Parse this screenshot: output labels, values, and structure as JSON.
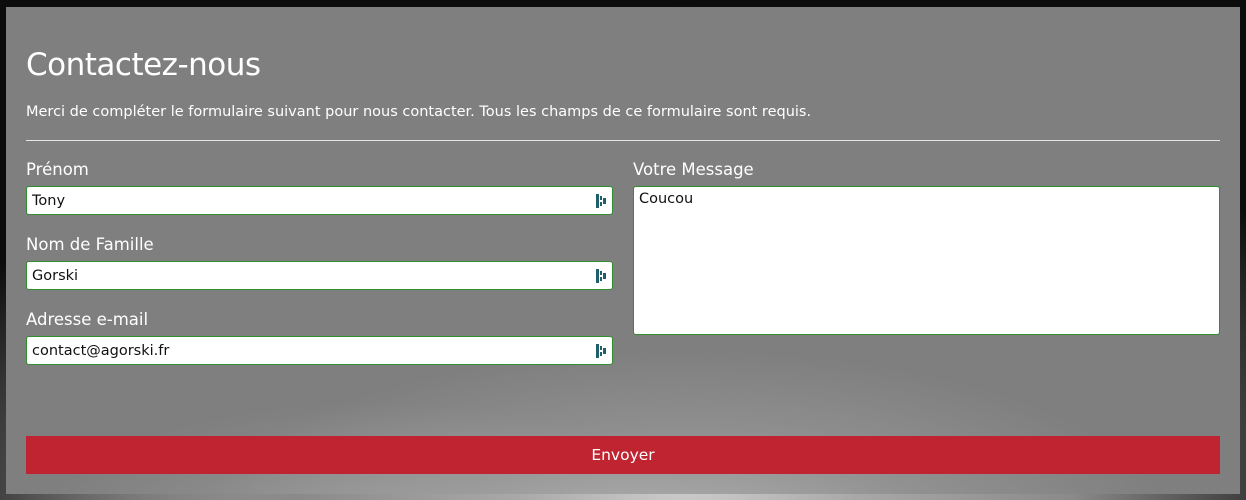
{
  "form": {
    "title": "Contactez-nous",
    "intro": "Merci de compléter le formulaire suivant pour nous contacter. Tous les champs de ce formulaire sont requis.",
    "first_name": {
      "label": "Prénom",
      "value": "Tony"
    },
    "last_name": {
      "label": "Nom de Famille",
      "value": "Gorski"
    },
    "email": {
      "label": "Adresse e-mail",
      "value": "contact@agorski.fr"
    },
    "message": {
      "label": "Votre Message",
      "value": "Coucou"
    },
    "submit_label": "Envoyer",
    "autofill_icon": "password-manager-key-icon"
  },
  "colors": {
    "panel": "#7f7f7f",
    "submit": "#bf2430",
    "field_border": "#2f8f2f",
    "text": "#ffffff"
  }
}
